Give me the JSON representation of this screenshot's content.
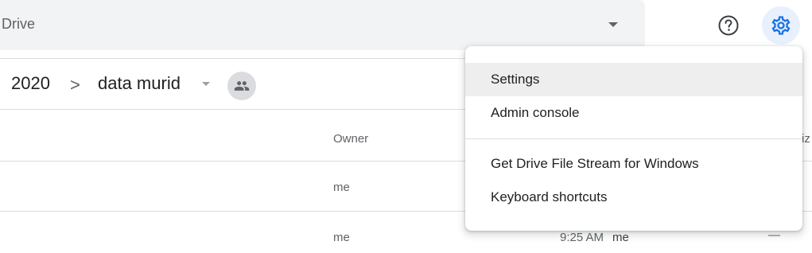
{
  "search": {
    "value": "Drive"
  },
  "header": {
    "help_icon": "help-circle-icon",
    "settings_icon": "gear-icon"
  },
  "breadcrumb": {
    "items": [
      "2020",
      "data murid"
    ],
    "separator": ">",
    "shared_icon": "people-icon"
  },
  "table": {
    "columns": [
      "Owner",
      "iz"
    ],
    "rows": [
      {
        "owner": "me",
        "modified": "",
        "modified_by": "",
        "size": ""
      },
      {
        "owner": "me",
        "modified": "9:25 AM",
        "modified_by": "me",
        "size": "—"
      }
    ]
  },
  "menu": {
    "items": [
      "Settings",
      "Admin console",
      "Get Drive File Stream for Windows",
      "Keyboard shortcuts"
    ],
    "highlighted": "Settings"
  },
  "colors": {
    "accent": "#1a73e8",
    "settings_bg": "#e8f0fe",
    "search_bg": "#f1f3f4"
  }
}
